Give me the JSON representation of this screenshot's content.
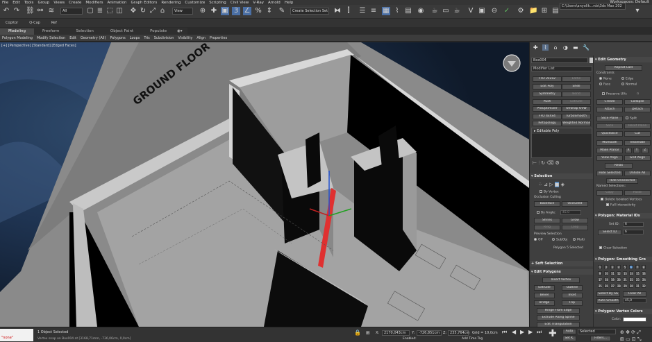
{
  "menu": {
    "items": [
      "File",
      "Edit",
      "Tools",
      "Group",
      "Views",
      "Create",
      "Modifiers",
      "Animation",
      "Graph Editors",
      "Rendering",
      "Customize",
      "Scripting",
      "Civil View",
      "V-Ray",
      "Arnold",
      "Help"
    ],
    "workspace": "Workspaces:  Default"
  },
  "toolbar": {
    "selection_filter": "All",
    "view_dropdown": "View",
    "create_selection_set": "Create Selection Set",
    "path": "C:\\Users\\anyolik...rds\\3ds Max 202"
  },
  "row2": {
    "items": [
      "Copitor",
      "Q-Cap",
      "Ref"
    ]
  },
  "ribbon": {
    "tabs": [
      "Modeling",
      "Freeform",
      "Selection",
      "Object Paint",
      "Populate"
    ],
    "sub_items": [
      "Polygon Modeling",
      "Modify Selection",
      "Edit",
      "Geometry (All)",
      "Polygons",
      "Loops",
      "Tris",
      "Subdivision",
      "Visibility",
      "Align",
      "Properties"
    ]
  },
  "viewport": {
    "label": "[+] [Perspective] [Standard] [Edged Faces]",
    "ground_text": "GROUND FLOOR"
  },
  "command_panel": {
    "object_name": "Box004",
    "modifier_list": "Modifier List",
    "modifier_buttons": [
      [
        "FFD 2x2x2",
        "Lathe"
      ],
      [
        "Edit Poly",
        "Shell"
      ],
      [
        "Symmetry",
        "Bend"
      ],
      [
        "Push",
        "Extrude"
      ],
      [
        "ProOptimizer",
        "Unwrap UVW"
      ],
      [
        "FFD 4x4x4",
        "TurboSmooth"
      ],
      [
        "Retopology",
        "Weighted Normals"
      ]
    ],
    "stack_item": "Editable Poly",
    "selection": {
      "title": "Selection",
      "by_vertex": "By Vertex",
      "ignore_backfacing": "Ignore Backfacing",
      "by_angle": "By Angle:",
      "by_angle_value": "45.0",
      "occlusion_culling": "Occlusion Culling",
      "backface": "Backface",
      "occluded": "Occluded",
      "shrink": "Shrink",
      "grow": "Grow",
      "ring": "Ring",
      "loop": "Loop",
      "preview_selection": "Preview Selection",
      "preview_off": "Off",
      "preview_subobj": "SubObj",
      "preview_multi": "Multi",
      "status": "Polygon 5 Selected"
    },
    "soft_selection": "Soft Selection",
    "edit_polygons": {
      "title": "Edit Polygons",
      "insert_vertex": "Insert Vertex",
      "extrude": "Extrude",
      "outline": "Outline",
      "bevel": "Bevel",
      "inset": "Inset",
      "bridge": "Bridge",
      "flip": "Flip",
      "hinge": "Hinge From Edge",
      "extrude_spline": "Extrude Along Spline",
      "edit_triangulation": "Edit Triangulation"
    }
  },
  "edit_geometry": {
    "title": "Edit Geometry",
    "repeat_last": "Repeat Last",
    "constraints": "Constraints",
    "c_none": "None",
    "c_edge": "Edge",
    "c_face": "Face",
    "c_normal": "Normal",
    "preserve_uvs": "Preserve UVs",
    "create": "Create",
    "collapse": "Collapse",
    "attach": "Attach",
    "detach": "Detach",
    "slice_plane": "Slice Plane",
    "split": "Split",
    "slice": "Slice",
    "reset_plane": "Reset Plane",
    "quickslice": "QuickSlice",
    "cut": "Cut",
    "msmooth": "MSmooth",
    "tessellate": "Tessellate",
    "make_planar": "Make Planar",
    "x": "X",
    "y": "Y",
    "z": "Z",
    "view_align": "View Align",
    "grid_align": "Grid Align",
    "relax": "Relax",
    "hide_selected": "Hide Selected",
    "unhide_all": "Unhide All",
    "hide_unselected": "Hide Unselected",
    "named_selections": "Named Selections:",
    "copy": "Copy",
    "paste": "Paste",
    "delete_isolated": "Delete Isolated Vertices",
    "full_interactivity": "Full Interactivity"
  },
  "material_ids": {
    "title": "Polygon: Material IDs",
    "set_id": "Set ID:",
    "set_id_value": "6",
    "select_id": "Select ID",
    "select_id_value": "6",
    "clear_selection": "Clear Selection"
  },
  "smoothing": {
    "title": "Polygon: Smoothing Gro",
    "groups": [
      "1",
      "2",
      "3",
      "4",
      "5",
      "6",
      "7",
      "8",
      "9",
      "10",
      "11",
      "12",
      "13",
      "14",
      "15",
      "16",
      "17",
      "18",
      "19",
      "20",
      "21",
      "22",
      "23",
      "24",
      "25",
      "26",
      "27",
      "28",
      "29",
      "30",
      "31",
      "32"
    ],
    "active_group": "6",
    "select_by_sg": "Select By SG",
    "clear_all": "Clear All",
    "auto_smooth": "Auto Smooth",
    "auto_smooth_value": "45,0"
  },
  "vertex_colors": {
    "title": "Polygon: Vertex Colors",
    "color": "Color:"
  },
  "status": {
    "maxscript": "\"none\"",
    "objects_selected": "1 Object Selected",
    "prompt": "Vertex snap on Box004 at [3168,71mm, -736,06cm, 0,0cm]",
    "x_label": "X:",
    "x_value": "2170,043cm",
    "y_label": "Y:",
    "y_value": "-726,851cm",
    "z_label": "Z:",
    "z_value": "235,764cm",
    "grid": "Grid = 10,0cm",
    "auto": "Auto",
    "selected": "Selected",
    "set_k": "Set K.",
    "filters": "Filters...",
    "enabled": "Enabled:",
    "add_time_tag": "Add Time Tag"
  }
}
